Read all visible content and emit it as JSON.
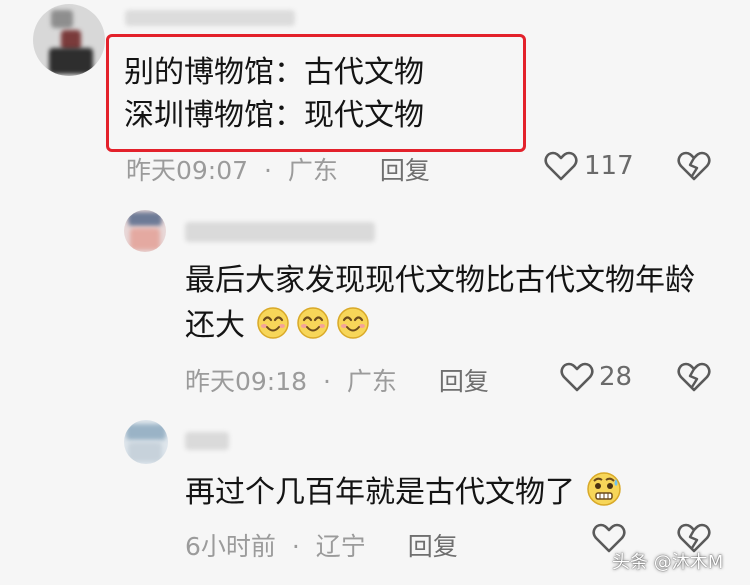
{
  "comment1": {
    "lines": [
      "别的博物馆：古代文物",
      "深圳博物馆：现代文物"
    ],
    "time": "昨天09:07",
    "dot": "·",
    "location": "广东",
    "reply": "回复",
    "likes": "117"
  },
  "reply1": {
    "text_line1": "最后大家发现现代文物比古代文物年龄",
    "text_line2": "还大",
    "emoji_count": 3,
    "time": "昨天09:18",
    "dot": "·",
    "location": "广东",
    "reply": "回复",
    "likes": "28"
  },
  "reply2": {
    "text": "再过个几百年就是古代文物了",
    "time": "6小时前",
    "dot": "·",
    "location": "辽宁",
    "reply": "回复"
  },
  "watermark": {
    "text": "头条 @沐木M"
  },
  "colors": {
    "highlight": "#e3212b",
    "meta": "#9b9b9b",
    "text": "#141414"
  }
}
